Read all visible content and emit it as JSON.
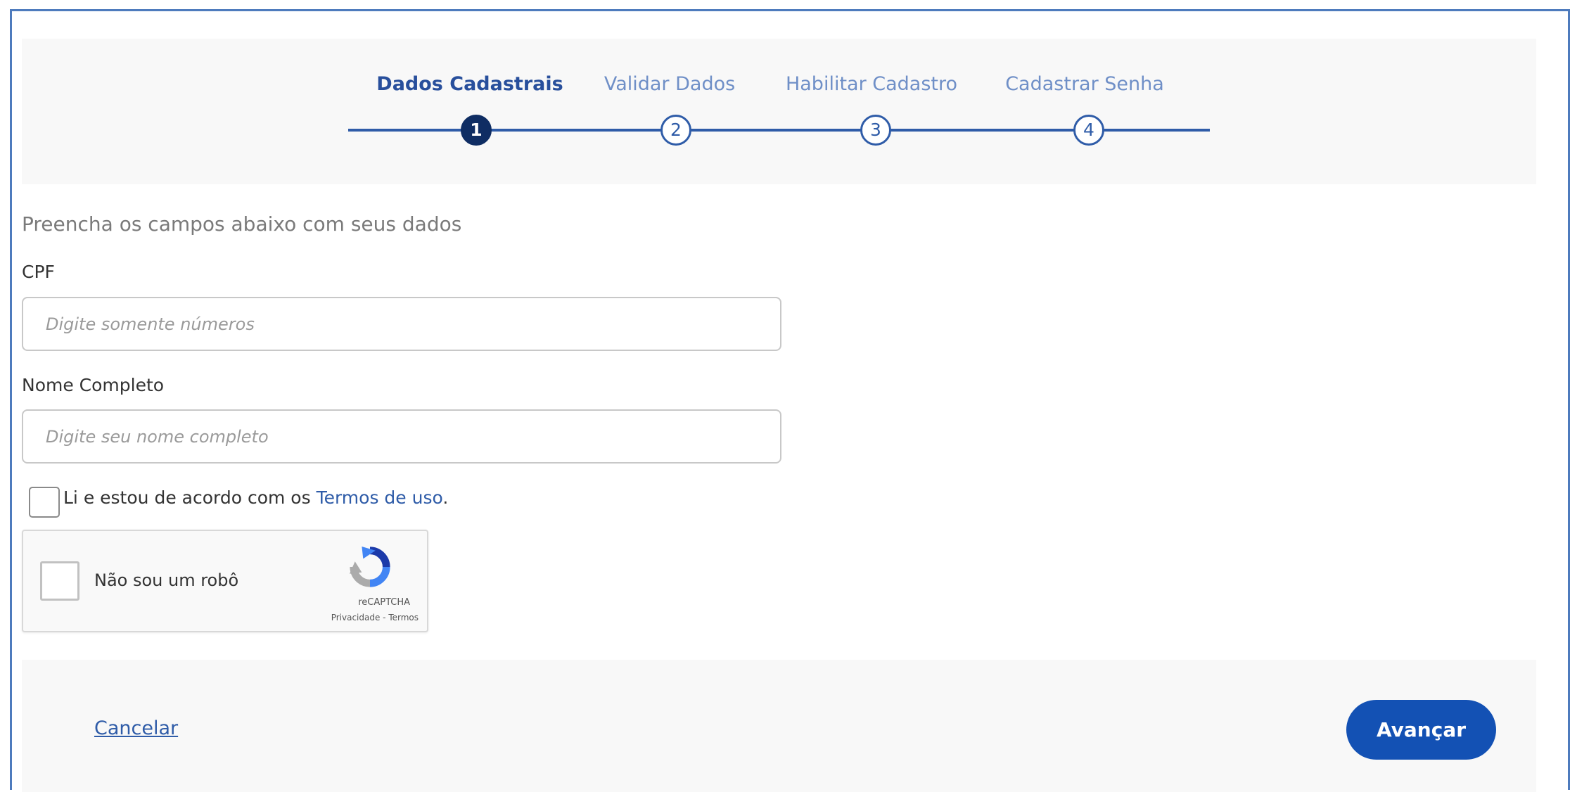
{
  "stepper": {
    "steps": [
      {
        "label": "Dados Cadastrais",
        "number": "1",
        "active": true
      },
      {
        "label": "Validar Dados",
        "number": "2",
        "active": false
      },
      {
        "label": "Habilitar Cadastro",
        "number": "3",
        "active": false
      },
      {
        "label": "Cadastrar Senha",
        "number": "4",
        "active": false
      }
    ]
  },
  "form": {
    "instructions": "Preencha os campos abaixo com seus dados",
    "cpf": {
      "label": "CPF",
      "placeholder": "Digite somente números",
      "value": ""
    },
    "full_name": {
      "label": "Nome Completo",
      "placeholder": "Digite seu nome completo",
      "value": ""
    },
    "terms": {
      "checked": false,
      "text_before": "Li e estou de acordo com os ",
      "link_text": "Termos de uso",
      "text_after": "."
    }
  },
  "recaptcha": {
    "label": "Não sou um robô",
    "brand": "reCAPTCHA",
    "links": "Privacidade - Termos",
    "checked": false
  },
  "footer": {
    "cancel_label": "Cancelar",
    "next_label": "Avançar"
  },
  "colors": {
    "accent": "#1351b4",
    "active_step": "#0f2d63",
    "link": "#2f5ca8",
    "panel_background": "#f8f8f8"
  }
}
